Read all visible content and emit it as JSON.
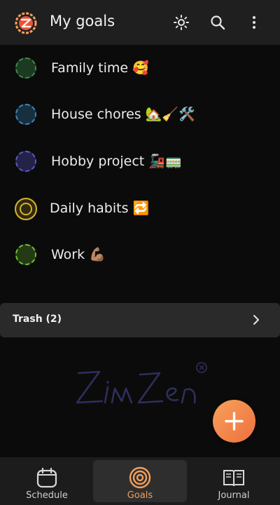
{
  "header": {
    "title": "My goals",
    "icons": [
      "zinzen-logo-icon",
      "sun-icon",
      "search-icon",
      "more-vertical-icon"
    ]
  },
  "goals": [
    {
      "label": "Family time 🥰",
      "color": "#3f8a4b",
      "style": "dashed"
    },
    {
      "label": "House chores 🏡🧹🛠️",
      "color": "#3f86b8",
      "style": "dashed"
    },
    {
      "label": "Hobby project 🚂🚃",
      "color": "#5a58c8",
      "style": "dashed"
    },
    {
      "label": "Daily habits 🔁",
      "color": "#d9b12a",
      "style": "solid-ring"
    },
    {
      "label": "Work 💪🏽",
      "color": "#6ec235",
      "style": "dashed"
    }
  ],
  "trash": {
    "label": "Trash (2)"
  },
  "bottom_nav": {
    "items": [
      {
        "label": "Schedule",
        "icon": "calendar-icon",
        "active": false
      },
      {
        "label": "Goals",
        "icon": "target-icon",
        "active": true
      },
      {
        "label": "Journal",
        "icon": "book-icon",
        "active": false
      }
    ]
  },
  "colors": {
    "accent": "#f29f5c",
    "fab": "#f0793f",
    "header_bg": "#1f1f1f",
    "page_bg": "#0b0b0b"
  }
}
